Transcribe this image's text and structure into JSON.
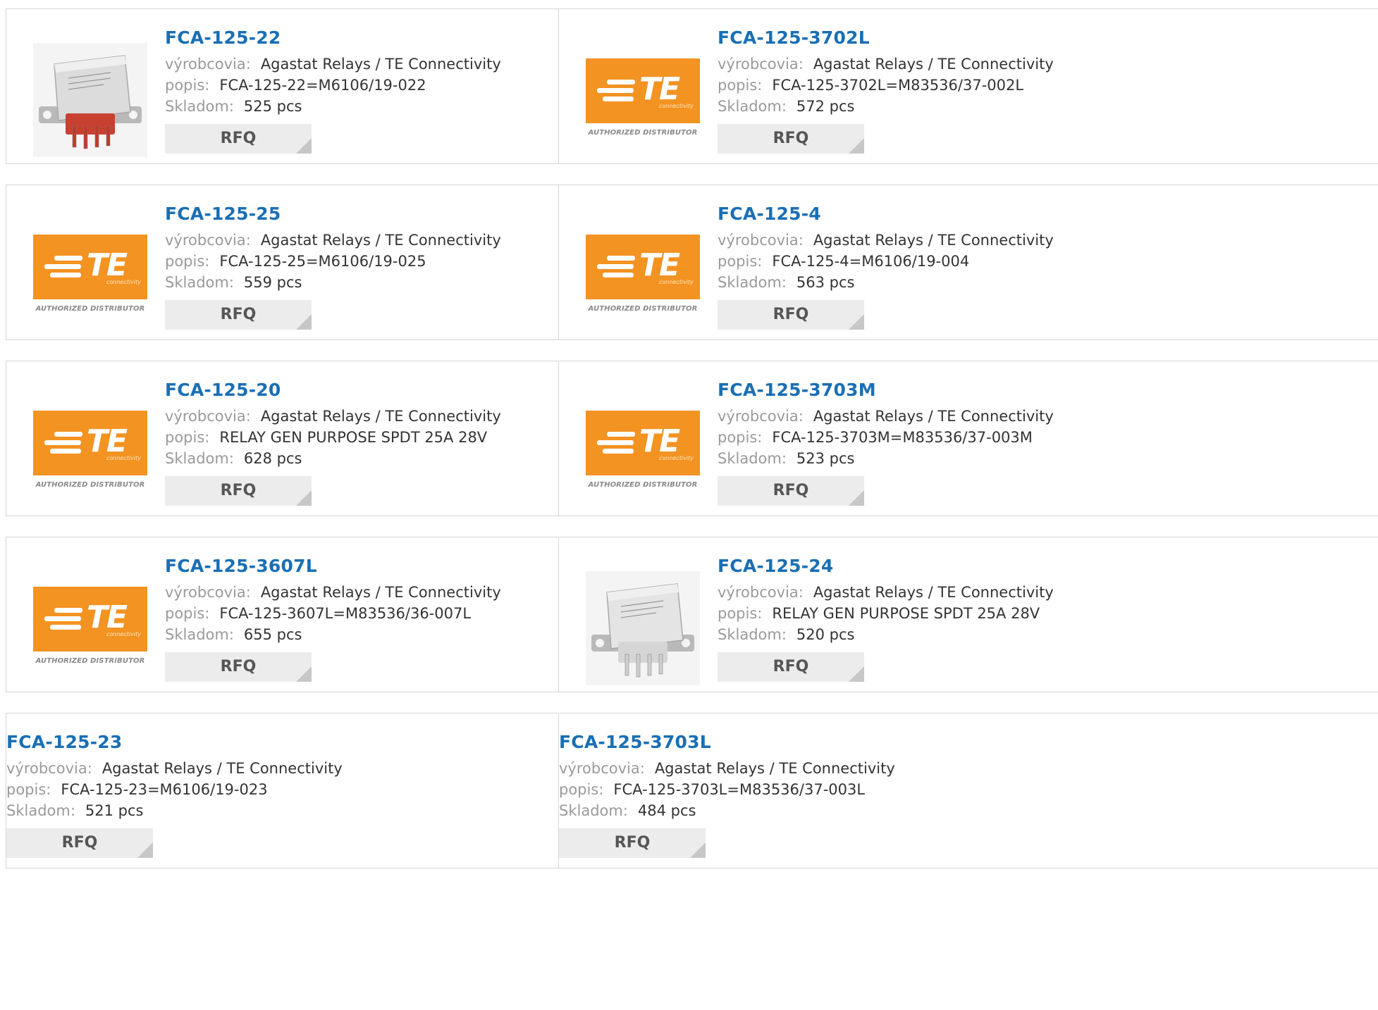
{
  "labels": {
    "manufacturer": "výrobcovia:",
    "description": "popis:",
    "stock": "Skladom:",
    "rfq": "RFQ"
  },
  "logo": {
    "word": "TE",
    "sub": "connectivity",
    "authorized": "AUTHORIZED DISTRIBUTOR"
  },
  "colors": {
    "title": "#1a6fb5",
    "te_orange": "#f39322",
    "button_bg": "#ececec",
    "label": "#9a9a9a"
  },
  "products": [
    {
      "title": "FCA-125-22",
      "manufacturer": "Agastat Relays / TE Connectivity",
      "description": "FCA-125-22=M6106/19-022",
      "stock": "525 pcs",
      "image": "relay-photo-red"
    },
    {
      "title": "FCA-125-3702L",
      "manufacturer": "Agastat Relays / TE Connectivity",
      "description": "FCA-125-3702L=M83536/37-002L",
      "stock": "572 pcs",
      "image": "te-logo"
    },
    {
      "title": "FCA-125-25",
      "manufacturer": "Agastat Relays / TE Connectivity",
      "description": "FCA-125-25=M6106/19-025",
      "stock": "559 pcs",
      "image": "te-logo"
    },
    {
      "title": "FCA-125-4",
      "manufacturer": "Agastat Relays / TE Connectivity",
      "description": "FCA-125-4=M6106/19-004",
      "stock": "563 pcs",
      "image": "te-logo"
    },
    {
      "title": "FCA-125-20",
      "manufacturer": "Agastat Relays / TE Connectivity",
      "description": "RELAY GEN PURPOSE SPDT 25A 28V",
      "stock": "628 pcs",
      "image": "te-logo"
    },
    {
      "title": "FCA-125-3703M",
      "manufacturer": "Agastat Relays / TE Connectivity",
      "description": "FCA-125-3703M=M83536/37-003M",
      "stock": "523 pcs",
      "image": "te-logo"
    },
    {
      "title": "FCA-125-3607L",
      "manufacturer": "Agastat Relays / TE Connectivity",
      "description": "FCA-125-3607L=M83536/36-007L",
      "stock": "655 pcs",
      "image": "te-logo"
    },
    {
      "title": "FCA-125-24",
      "manufacturer": "Agastat Relays / TE Connectivity",
      "description": "RELAY GEN PURPOSE SPDT 25A 28V",
      "stock": "520 pcs",
      "image": "relay-photo-silver"
    },
    {
      "title": "FCA-125-23",
      "manufacturer": "Agastat Relays / TE Connectivity",
      "description": "FCA-125-23=M6106/19-023",
      "stock": "521 pcs",
      "image": ""
    },
    {
      "title": "FCA-125-3703L",
      "manufacturer": "Agastat Relays / TE Connectivity",
      "description": "FCA-125-3703L=M83536/37-003L",
      "stock": "484 pcs",
      "image": ""
    }
  ]
}
